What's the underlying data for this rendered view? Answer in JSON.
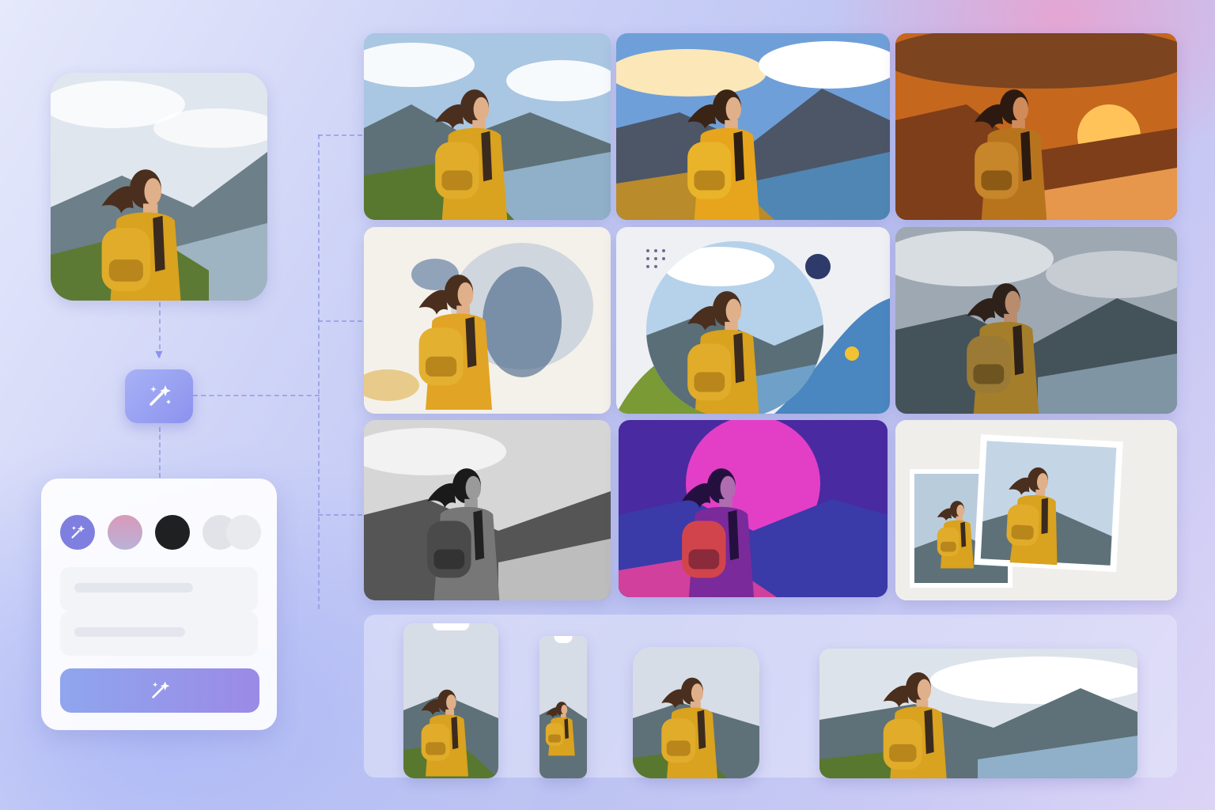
{
  "source": {
    "icon": "image-icon"
  },
  "workflow": {
    "node_icon": "magic-wand-icon"
  },
  "settings": {
    "swatches": [
      {
        "name": "magic",
        "color": "#7f7fe0",
        "icon": "sparkles-icon"
      },
      {
        "name": "gradient",
        "color": "#d8a4c4"
      },
      {
        "name": "dark",
        "color": "#1f2022"
      },
      {
        "name": "light-a",
        "color": "#e2e3e8"
      },
      {
        "name": "light-b",
        "color": "#e9eaee"
      }
    ],
    "generate_icon": "magic-wand-icon"
  },
  "variations": [
    {
      "style": "natural"
    },
    {
      "style": "vivid"
    },
    {
      "style": "sunset"
    },
    {
      "style": "watercolor"
    },
    {
      "style": "graphic-collage"
    },
    {
      "style": "moody"
    },
    {
      "style": "black-and-white"
    },
    {
      "style": "synthwave"
    },
    {
      "style": "polaroid-collage"
    }
  ],
  "formats": [
    {
      "name": "phone-tall"
    },
    {
      "name": "phone-narrow"
    },
    {
      "name": "square"
    },
    {
      "name": "wide-banner"
    }
  ],
  "colors": {
    "accent": "#8c92ee",
    "jacket": "#d9a21f"
  }
}
